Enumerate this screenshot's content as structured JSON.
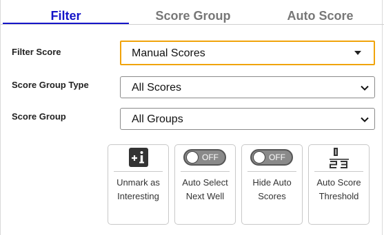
{
  "tabs": [
    {
      "label": "Filter"
    },
    {
      "label": "Score Group"
    },
    {
      "label": "Auto Score"
    }
  ],
  "filters": {
    "filter_score": {
      "label": "Filter Score",
      "value": "Manual Scores"
    },
    "score_group_type": {
      "label": "Score Group Type",
      "value": "All Scores"
    },
    "score_group": {
      "label": "Score Group",
      "value": "All Groups"
    }
  },
  "tiles": [
    {
      "line1": "Unmark as",
      "line2": "Interesting",
      "icon": "plus-info-icon"
    },
    {
      "line1": "Auto Select",
      "line2": "Next Well",
      "icon": "toggle-off-icon",
      "toggle_text": "OFF"
    },
    {
      "line1": "Hide Auto",
      "line2": "Scores",
      "icon": "toggle-off-icon",
      "toggle_text": "OFF"
    },
    {
      "line1": "Auto Score",
      "line2": "Threshold",
      "icon": "one-two-three-icon"
    }
  ],
  "colors": {
    "active_tab": "#1414c8",
    "focus_border": "#f0a30a",
    "inactive_tab": "#777777"
  }
}
